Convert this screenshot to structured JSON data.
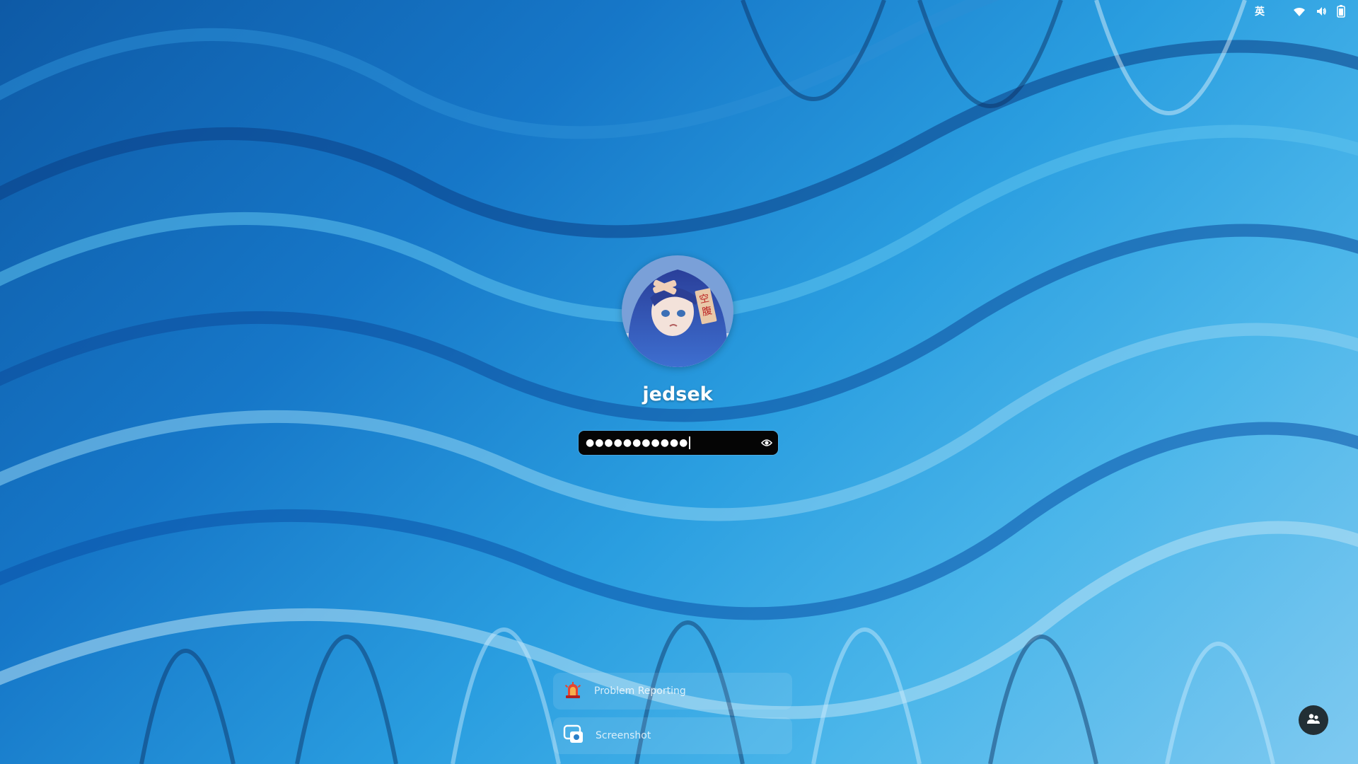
{
  "topbar": {
    "input_method": "英",
    "icons": [
      "wifi-icon",
      "volume-icon",
      "battery-icon"
    ]
  },
  "login": {
    "username": "jedsek",
    "password_mask": "●●●●●●●●●●●",
    "reveal_icon": "eye-icon"
  },
  "bottom_items": [
    {
      "label": "Problem Reporting",
      "icon": "siren-icon"
    },
    {
      "label": "Screenshot",
      "icon": "screenshot-icon"
    }
  ],
  "switch_user_icon": "users-icon",
  "colors": {
    "accent": "#1677c8",
    "field_bg": "#050505",
    "text": "#ffffff"
  }
}
